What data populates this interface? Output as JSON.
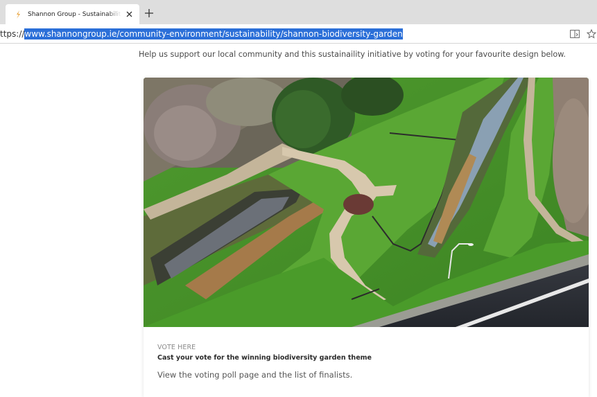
{
  "browser": {
    "tab": {
      "title": "Shannon Group - Sustainability - Shannon Biodiversity Garden",
      "close_glyph": "✕",
      "favicon_icon": "shannon-group-favicon",
      "accent": "#e8a23a"
    },
    "new_tab_glyph": "+",
    "address": {
      "url_prefix": "ttps://",
      "url_selected": "www.shannongroup.ie/community-environment/sustainability/shannon-biodiversity-garden",
      "selection_color": "#2b6fd8",
      "icons": [
        "reading-view-icon",
        "favorite-star-icon"
      ]
    }
  },
  "page": {
    "intro": "Help us support our local community and this sustainaility initiative by voting for your favourite design below.",
    "card": {
      "image_alt_icon": "aerial-garden-photo",
      "eyebrow": "VOTE HERE",
      "heading": "Cast your vote for the winning biodiversity garden theme",
      "text": "View the voting poll page and the list of finalists."
    }
  }
}
